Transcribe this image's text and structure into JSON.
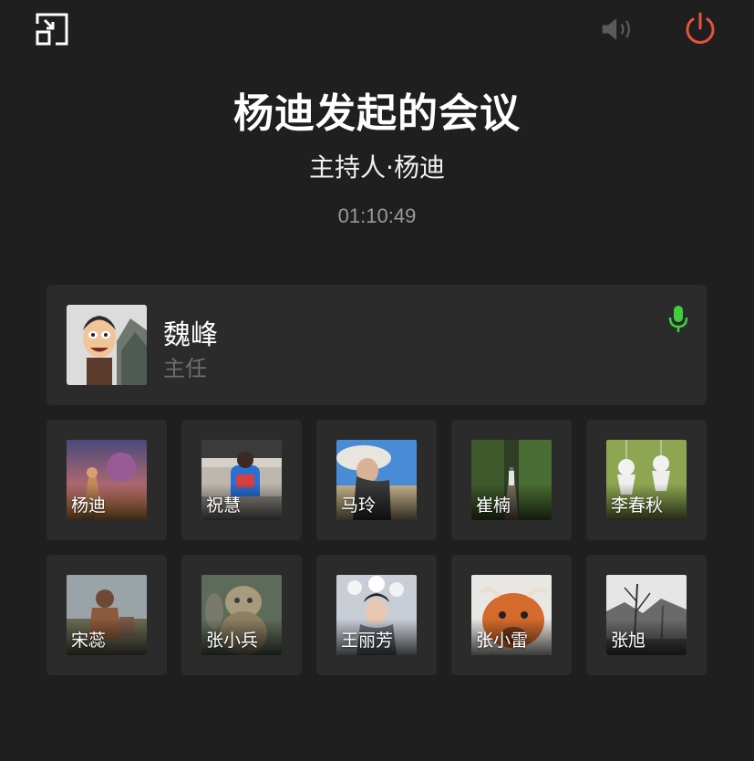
{
  "icons": {
    "minimize": "minimize-window-icon",
    "speaker": "speaker-icon",
    "power": "power-icon",
    "mic": "microphone-icon"
  },
  "colors": {
    "power": "#e5533b",
    "mic": "#3ecf3e",
    "speaker": "#5a5a5a"
  },
  "meeting": {
    "title": "杨迪发起的会议",
    "host": "主持人·杨迪",
    "duration": "01:10:49"
  },
  "active_speaker": {
    "name": "魏峰",
    "role": "主任"
  },
  "participants": [
    {
      "name": "杨迪"
    },
    {
      "name": "祝慧"
    },
    {
      "name": "马玲"
    },
    {
      "name": "崔楠"
    },
    {
      "name": "李春秋"
    },
    {
      "name": "宋蕊"
    },
    {
      "name": "张小兵"
    },
    {
      "name": "王丽芳"
    },
    {
      "name": "张小雷"
    },
    {
      "name": "张旭"
    }
  ]
}
